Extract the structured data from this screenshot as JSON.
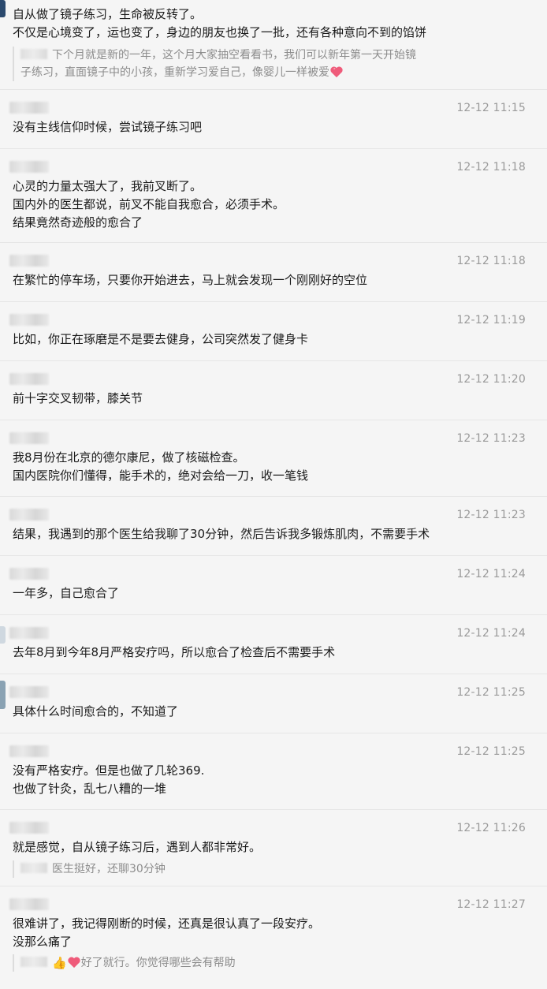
{
  "messages": [
    {
      "lines": [
        "自从做了镜子练习，生命被反转了。",
        "不仅是心境变了，运也变了，身边的朋友也换了一批，还有各种意向不到的馅饼"
      ],
      "quote": {
        "lines": [
          "下个月就是新的一年，这个月大家抽空看看书，我们可以新年第一天开始镜",
          "子练习，直面镜子中的小孩，重新学习爱自己，像婴儿一样被爱"
        ],
        "icon": "heart-icon"
      }
    },
    {
      "time": "12-12 11:15",
      "lines": [
        "没有主线信仰时候，尝试镜子练习吧"
      ]
    },
    {
      "time": "12-12 11:18",
      "lines": [
        "心灵的力量太强大了，我前叉断了。",
        "国内外的医生都说，前叉不能自我愈合，必须手术。",
        "结果竟然奇迹般的愈合了"
      ]
    },
    {
      "time": "12-12 11:18",
      "lines": [
        "在繁忙的停车场，只要你开始进去，马上就会发现一个刚刚好的空位"
      ]
    },
    {
      "time": "12-12 11:19",
      "lines": [
        "比如，你正在琢磨是不是要去健身，公司突然发了健身卡"
      ]
    },
    {
      "time": "12-12 11:20",
      "lines": [
        "前十字交叉韧带，膝关节"
      ]
    },
    {
      "time": "12-12 11:23",
      "lines": [
        "我8月份在北京的德尔康尼，做了核磁检查。",
        "国内医院你们懂得，能手术的，绝对会给一刀，收一笔钱"
      ]
    },
    {
      "time": "12-12 11:23",
      "lines": [
        "结果，我遇到的那个医生给我聊了30分钟，然后告诉我多锻炼肌肉，不需要手术"
      ]
    },
    {
      "time": "12-12 11:24",
      "lines": [
        "一年多，自己愈合了"
      ]
    },
    {
      "time": "12-12 11:24",
      "lines": [
        "去年8月到今年8月严格安疗吗，所以愈合了检查后不需要手术"
      ]
    },
    {
      "time": "12-12 11:25",
      "lines": [
        "具体什么时间愈合的，不知道了"
      ]
    },
    {
      "time": "12-12 11:25",
      "lines": [
        "没有严格安疗。但是也做了几轮369.",
        "也做了针灸，乱七八糟的一堆"
      ]
    },
    {
      "time": "12-12 11:26",
      "lines": [
        "就是感觉，自从镜子练习后，遇到人都非常好。"
      ],
      "quote": {
        "lines": [
          "医生挺好，还聊30分钟"
        ]
      }
    },
    {
      "time": "12-12 11:27",
      "lines": [
        "很难讲了，我记得刚断的时候，还真是很认真了一段安疗。",
        "没那么痛了"
      ],
      "quote": {
        "lines": [
          "好了就行。你觉得哪些会有帮助"
        ],
        "icon": "thumbs-up-heart-icon"
      }
    }
  ]
}
